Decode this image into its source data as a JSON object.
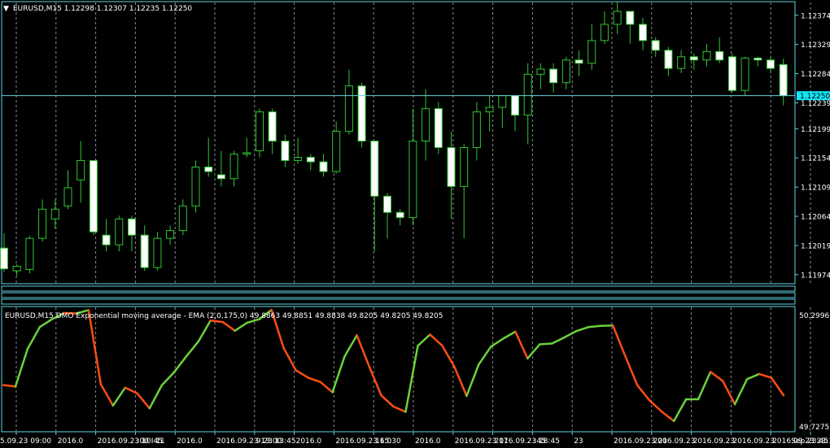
{
  "main": {
    "header_text": "EURUSD,M15  1.12298 1.12307 1.12235 1.12250",
    "price_ticks": [
      "1.12374",
      "1.12329",
      "1.12284",
      "1.12239",
      "1.12199",
      "1.12154",
      "1.12109",
      "1.12064",
      "1.12019",
      "1.11974"
    ],
    "current_price": "1.12250"
  },
  "indicator": {
    "header_text": "EURUSD,M15 DMO Exponential moving average - EMA (2,0,175,0) 49.8863 49.8851 49.8838 49.8205 49.8205 49.8205",
    "ticks": [
      "50.2996",
      "49.7275"
    ]
  },
  "time_axis": {
    "labels": [
      "5.09.23 09:00",
      "2016.0",
      "2016.09.23 10:45",
      ":00 I 11",
      "2016.0",
      "2016.09.23 13:00",
      "9.23 13:45",
      "2016.0",
      "2016.09.23 15:30",
      "16.0",
      "2016.0",
      "2016.09.23 17",
      "2016.09.23 18:45",
      ":45",
      "23",
      "2016.09.23 20",
      "2016.09.23",
      "2016.09.23",
      "2016.09.23",
      "2016.09.23 23:15",
      "Sep 23:45"
    ]
  },
  "colors": {
    "background": "#000000",
    "axis": "#5fd4e0",
    "grid": "#c8c8c8",
    "bull_body": "#000000",
    "bear_body": "#ffffff",
    "candle_outline": "#2fc52f",
    "ema_up": "#6bd23a",
    "ema_down": "#ff4d14",
    "price_marker": "#12e5f5"
  },
  "chart_data": [
    {
      "type": "candlestick",
      "title": "EURUSD,M15",
      "y_ticks": [
        1.12374,
        1.12329,
        1.12284,
        1.12239,
        1.12199,
        1.12154,
        1.12109,
        1.12064,
        1.12019,
        1.11974
      ],
      "ylim": [
        1.1196,
        1.12395
      ],
      "current_price": 1.1225,
      "candles": [
        {
          "o": 1.12015,
          "h": 1.12038,
          "l": 1.11978,
          "c": 1.11983
        },
        {
          "o": 1.1198,
          "h": 1.1199,
          "l": 1.11972,
          "c": 1.11987
        },
        {
          "o": 1.11982,
          "h": 1.12034,
          "l": 1.11976,
          "c": 1.1203
        },
        {
          "o": 1.1203,
          "h": 1.1209,
          "l": 1.12025,
          "c": 1.12075
        },
        {
          "o": 1.1206,
          "h": 1.1209,
          "l": 1.12045,
          "c": 1.12075
        },
        {
          "o": 1.1208,
          "h": 1.12135,
          "l": 1.12075,
          "c": 1.12108
        },
        {
          "o": 1.1212,
          "h": 1.1218,
          "l": 1.12085,
          "c": 1.1215
        },
        {
          "o": 1.1215,
          "h": 1.1215,
          "l": 1.12035,
          "c": 1.1204
        },
        {
          "o": 1.12035,
          "h": 1.1206,
          "l": 1.1201,
          "c": 1.1202
        },
        {
          "o": 1.1202,
          "h": 1.12065,
          "l": 1.1201,
          "c": 1.1206
        },
        {
          "o": 1.1206,
          "h": 1.12065,
          "l": 1.1201,
          "c": 1.12035
        },
        {
          "o": 1.12035,
          "h": 1.1205,
          "l": 1.1198,
          "c": 1.11985
        },
        {
          "o": 1.11985,
          "h": 1.1204,
          "l": 1.1198,
          "c": 1.1203
        },
        {
          "o": 1.1203,
          "h": 1.1205,
          "l": 1.1202,
          "c": 1.12042
        },
        {
          "o": 1.12042,
          "h": 1.1209,
          "l": 1.12035,
          "c": 1.1208
        },
        {
          "o": 1.1208,
          "h": 1.1215,
          "l": 1.1207,
          "c": 1.1214
        },
        {
          "o": 1.1214,
          "h": 1.12185,
          "l": 1.12125,
          "c": 1.12133
        },
        {
          "o": 1.12128,
          "h": 1.12165,
          "l": 1.1211,
          "c": 1.12122
        },
        {
          "o": 1.12122,
          "h": 1.12165,
          "l": 1.1211,
          "c": 1.1216
        },
        {
          "o": 1.1216,
          "h": 1.12185,
          "l": 1.12155,
          "c": 1.12162
        },
        {
          "o": 1.12165,
          "h": 1.1223,
          "l": 1.12155,
          "c": 1.12225
        },
        {
          "o": 1.12225,
          "h": 1.1223,
          "l": 1.1216,
          "c": 1.1218
        },
        {
          "o": 1.1218,
          "h": 1.1219,
          "l": 1.1214,
          "c": 1.1215
        },
        {
          "o": 1.1215,
          "h": 1.12185,
          "l": 1.12145,
          "c": 1.12155
        },
        {
          "o": 1.12155,
          "h": 1.1216,
          "l": 1.12135,
          "c": 1.12148
        },
        {
          "o": 1.12148,
          "h": 1.1216,
          "l": 1.12125,
          "c": 1.12133
        },
        {
          "o": 1.12133,
          "h": 1.1221,
          "l": 1.1213,
          "c": 1.12195
        },
        {
          "o": 1.12195,
          "h": 1.1229,
          "l": 1.1219,
          "c": 1.12265
        },
        {
          "o": 1.12265,
          "h": 1.1227,
          "l": 1.1217,
          "c": 1.1218
        },
        {
          "o": 1.1218,
          "h": 1.1218,
          "l": 1.1201,
          "c": 1.12095
        },
        {
          "o": 1.12095,
          "h": 1.121,
          "l": 1.1203,
          "c": 1.1207
        },
        {
          "o": 1.1207,
          "h": 1.12075,
          "l": 1.1205,
          "c": 1.12062
        },
        {
          "o": 1.12062,
          "h": 1.1223,
          "l": 1.1205,
          "c": 1.1218
        },
        {
          "o": 1.1218,
          "h": 1.1226,
          "l": 1.1215,
          "c": 1.1223
        },
        {
          "o": 1.1223,
          "h": 1.1224,
          "l": 1.1216,
          "c": 1.1217
        },
        {
          "o": 1.1217,
          "h": 1.12195,
          "l": 1.1206,
          "c": 1.1211
        },
        {
          "o": 1.1211,
          "h": 1.12175,
          "l": 1.1203,
          "c": 1.1217
        },
        {
          "o": 1.1217,
          "h": 1.1224,
          "l": 1.1215,
          "c": 1.12225
        },
        {
          "o": 1.12225,
          "h": 1.1225,
          "l": 1.12195,
          "c": 1.12232
        },
        {
          "o": 1.12232,
          "h": 1.12245,
          "l": 1.122,
          "c": 1.1225
        },
        {
          "o": 1.1225,
          "h": 1.1225,
          "l": 1.12195,
          "c": 1.1222
        },
        {
          "o": 1.1222,
          "h": 1.123,
          "l": 1.12175,
          "c": 1.12283
        },
        {
          "o": 1.12283,
          "h": 1.123,
          "l": 1.1226,
          "c": 1.12291
        },
        {
          "o": 1.12291,
          "h": 1.123,
          "l": 1.12255,
          "c": 1.1227
        },
        {
          "o": 1.1227,
          "h": 1.1231,
          "l": 1.1226,
          "c": 1.12305
        },
        {
          "o": 1.12305,
          "h": 1.1232,
          "l": 1.1228,
          "c": 1.123
        },
        {
          "o": 1.123,
          "h": 1.1236,
          "l": 1.1229,
          "c": 1.12335
        },
        {
          "o": 1.12335,
          "h": 1.1238,
          "l": 1.1233,
          "c": 1.1236
        },
        {
          "o": 1.1236,
          "h": 1.12395,
          "l": 1.12345,
          "c": 1.1238
        },
        {
          "o": 1.1238,
          "h": 1.1238,
          "l": 1.1233,
          "c": 1.1236
        },
        {
          "o": 1.1236,
          "h": 1.1237,
          "l": 1.1232,
          "c": 1.12335
        },
        {
          "o": 1.12335,
          "h": 1.1234,
          "l": 1.1231,
          "c": 1.1232
        },
        {
          "o": 1.1232,
          "h": 1.12325,
          "l": 1.1228,
          "c": 1.12292
        },
        {
          "o": 1.12292,
          "h": 1.1232,
          "l": 1.12285,
          "c": 1.1231
        },
        {
          "o": 1.1231,
          "h": 1.12315,
          "l": 1.1229,
          "c": 1.12305
        },
        {
          "o": 1.12305,
          "h": 1.1233,
          "l": 1.12295,
          "c": 1.12318
        },
        {
          "o": 1.12318,
          "h": 1.1234,
          "l": 1.123,
          "c": 1.12305
        },
        {
          "o": 1.1231,
          "h": 1.12315,
          "l": 1.12255,
          "c": 1.12258
        },
        {
          "o": 1.12258,
          "h": 1.1231,
          "l": 1.1225,
          "c": 1.12308
        },
        {
          "o": 1.12308,
          "h": 1.1231,
          "l": 1.12295,
          "c": 1.12305
        },
        {
          "o": 1.12305,
          "h": 1.1231,
          "l": 1.12285,
          "c": 1.12292
        },
        {
          "o": 1.12298,
          "h": 1.12307,
          "l": 1.12235,
          "c": 1.1225
        }
      ]
    },
    {
      "type": "line",
      "title": "EURUSD,M15 DMO Exponential moving average - EMA (2,0,175,0)",
      "ylim": [
        49.7275,
        50.2996
      ],
      "y_ticks": [
        50.2996,
        49.7275
      ],
      "values": [
        49.9236,
        49.9167,
        50.1048,
        50.2136,
        50.2528,
        50.2832,
        50.2813,
        50.2978,
        49.9281,
        49.8217,
        49.9109,
        49.8816,
        49.8079,
        49.9225,
        49.9873,
        50.066,
        50.141,
        50.2458,
        50.2385,
        50.1951,
        50.2351,
        50.2528,
        50.2988,
        50.1082,
        49.9979,
        49.9605,
        49.9397,
        49.888,
        50.0675,
        50.1724,
        50.0184,
        49.8724,
        49.8166,
        49.7902,
        50.1198,
        50.1761,
        50.1206,
        50.0153,
        49.8699,
        50.0272,
        50.1156,
        50.1555,
        50.1905,
        50.0569,
        50.1271,
        50.131,
        50.1613,
        50.1934,
        50.2133,
        50.2196,
        50.2212,
        50.0702,
        49.9234,
        49.8474,
        49.7914,
        49.7444,
        49.8528,
        49.8531,
        49.9898,
        49.9452,
        49.8282,
        49.9532,
        49.9794,
        49.9599,
        49.8726
      ]
    }
  ]
}
